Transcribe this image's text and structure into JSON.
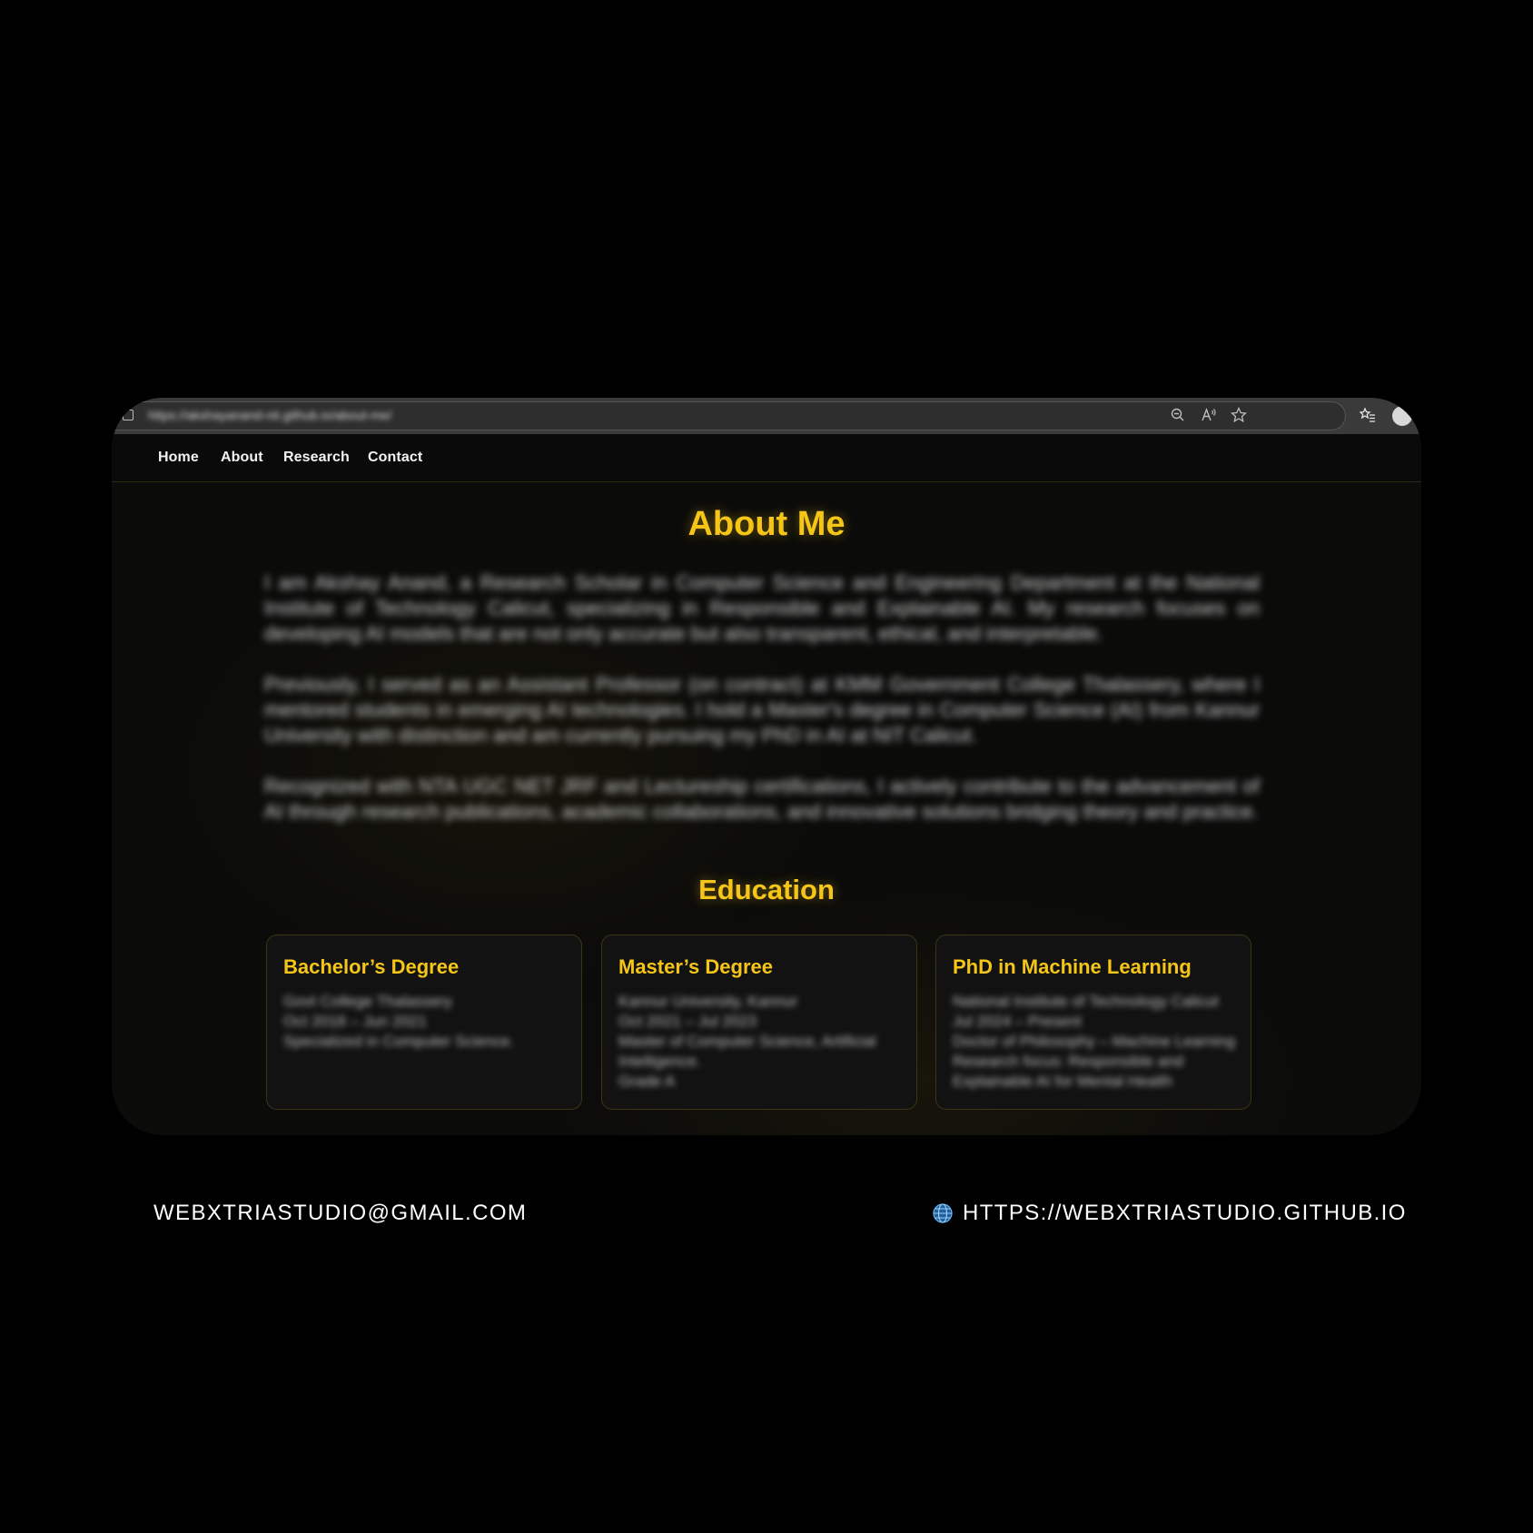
{
  "browser": {
    "url": "https://akshayanand-nit.github.io/about-me/"
  },
  "nav": {
    "items": [
      {
        "label": "Home"
      },
      {
        "label": "About"
      },
      {
        "label": "Research"
      },
      {
        "label": "Contact"
      }
    ]
  },
  "about": {
    "title": "About Me",
    "paragraph_1": "I am Akshay Anand, a Research Scholar in Computer Science and Engineering Department at the National Institute of Technology Calicut, specializing in Responsible and Explainable AI. My research focuses on developing AI models that are not only accurate but also transparent, ethical, and interpretable.",
    "paragraph_2": "Previously, I served as an Assistant Professor (on contract) at KMM Government College Thalassery, where I mentored students in emerging AI technologies. I hold a Master's degree in Computer Science (AI) from Kannur University with distinction and am currently pursuing my PhD in AI at NIT Calicut.",
    "paragraph_3": "Recognized with NTA UGC NET JRF and Lectureship certifications, I actively contribute to the advancement of AI through research publications, academic collaborations, and innovative solutions bridging theory and practice."
  },
  "education": {
    "title": "Education",
    "cards": [
      {
        "title": "Bachelor’s Degree",
        "lines": [
          "Govt College Thalassery",
          "Oct 2018 – Jun 2021",
          "Specialized in Computer Science."
        ]
      },
      {
        "title": "Master’s Degree",
        "lines": [
          "Kannur University, Kannur",
          "Oct 2021 – Jul 2023",
          "Master of Computer Science, Artificial",
          "Intelligence.",
          "Grade A"
        ]
      },
      {
        "title": "PhD in Machine Learning",
        "lines": [
          "National Institute of Technology Calicut",
          "Jul 2024 – Present",
          "Doctor of Philosophy – Machine Learning",
          "Research focus: Responsible and",
          "Explainable AI for Mental Health"
        ]
      }
    ]
  },
  "footer": {
    "email": "WEBXTRIASTUDIO@GMAIL.COM",
    "website": "HTTPS://WEBXTRIASTUDIO.GITHUB.IO"
  },
  "colors": {
    "accent": "#f5c518",
    "background": "#000000",
    "page": "#0b0b0a",
    "card": "#121212"
  },
  "icons": [
    "site-info-icon",
    "zoom-out-icon",
    "read-aloud-icon",
    "favorite-star-icon",
    "favorites-list-icon",
    "profile-avatar",
    "globe-icon"
  ]
}
